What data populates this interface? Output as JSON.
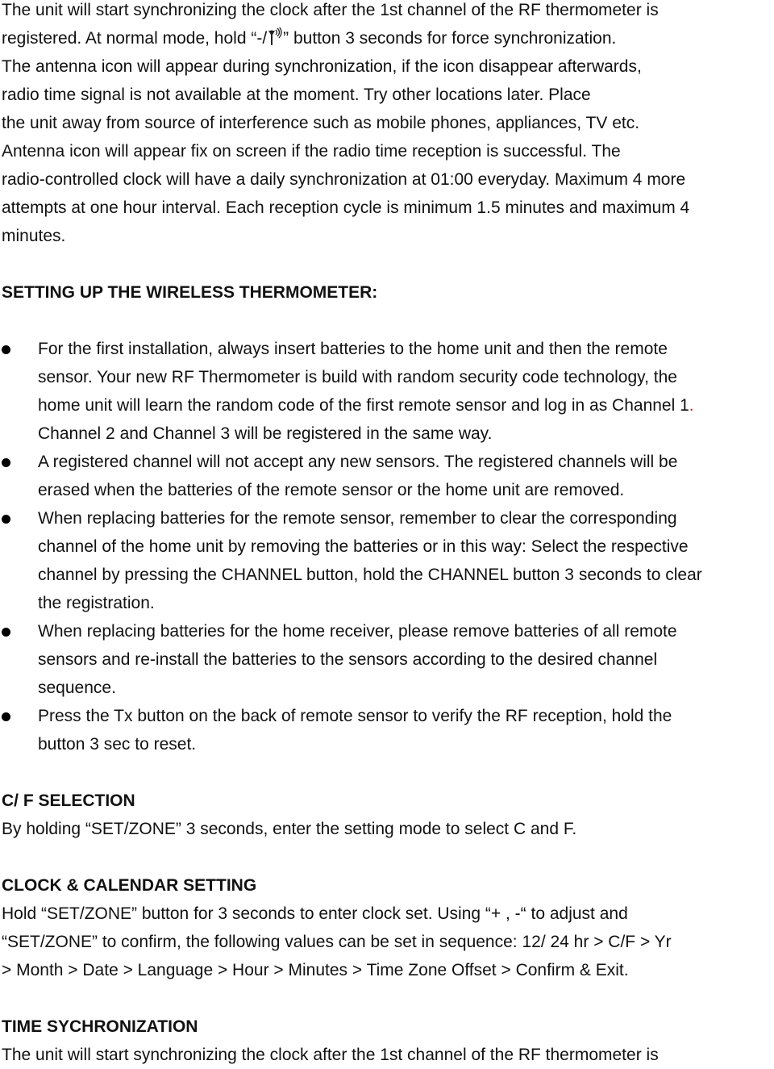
{
  "intro": {
    "lines": [
      "The unit will start synchronizing the clock after the 1st channel of the RF thermometer is",
      "registered. At normal mode, hold “-/",
      "” button 3 seconds for force synchronization.",
      "The antenna icon will appear during synchronization, if the icon disappear afterwards,",
      "radio time signal is not available at the moment. Try other locations later. Place",
      "the unit away from source of interference such as mobile phones, appliances, TV etc.",
      "Antenna icon will appear fix on screen if the radio time reception is successful. The",
      "radio-controlled clock will have a daily synchronization at 01:00 everyday. Maximum 4 more",
      "attempts at one hour interval. Each reception cycle is minimum 1.5 minutes and maximum 4",
      "minutes."
    ],
    "icon": "antenna-signal-icon"
  },
  "wireless": {
    "heading": "SETTING UP THE WIRELESS THERMOMETER:",
    "bullets": [
      {
        "lines": [
          "For the first installation, always insert batteries to the home unit and then the remote",
          "sensor. Your new RF Thermometer is build with random security code technology, the",
          "home unit will learn the random code of the first remote sensor and log in as Channel 1",
          "Channel 2 and Channel 3 will be registered in the same way."
        ],
        "red_period": "."
      },
      {
        "lines": [
          "A registered channel will not accept any new sensors. The registered channels will be",
          "erased when the batteries of the remote sensor or the home unit are removed."
        ]
      },
      {
        "lines": [
          "When replacing batteries for the remote sensor, remember to clear the corresponding",
          "channel of the home unit by removing the batteries or in this way: Select the respective",
          "channel by pressing the CHANNEL button, hold the CHANNEL button 3 seconds to clear",
          "the registration."
        ]
      },
      {
        "lines": [
          "When replacing batteries for the home receiver, please remove batteries of all remote",
          "sensors and re-install the batteries to the sensors according to the desired channel",
          "sequence."
        ]
      },
      {
        "lines": [
          "Press the Tx button on the back of remote sensor to verify the RF reception, hold the",
          "button 3 sec to reset."
        ]
      }
    ]
  },
  "cf_selection": {
    "heading": "C/ F SELECTION",
    "lines": [
      "By holding “SET/ZONE” 3 seconds, enter the setting mode to select C and F."
    ]
  },
  "clock_calendar": {
    "heading": "CLOCK & CALENDAR SETTING",
    "lines": [
      "Hold “SET/ZONE” button for 3 seconds to enter clock set. Using “+ , -“ to adjust and",
      "“SET/ZONE” to confirm, the following values can be set in sequence: 12/ 24 hr > C/F > Yr",
      "> Month > Date > Language > Hour > Minutes > Time Zone Offset > Confirm & Exit."
    ]
  },
  "time_sync": {
    "heading": "TIME SYCHRONIZATION",
    "lines": [
      "The unit will start synchronizing the clock after the 1st channel of the RF thermometer is"
    ]
  },
  "colors": {
    "text": "#111111",
    "highlight_red": "#cc2233"
  }
}
